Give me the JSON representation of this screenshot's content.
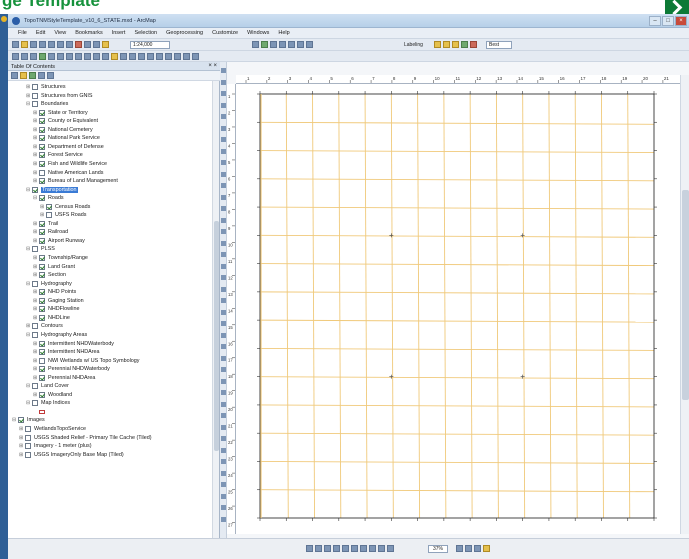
{
  "banner": {
    "heading": "ge Template"
  },
  "window": {
    "title": "TopoTNMStyleTemplate_v10_6_STATE.mxd - ArcMap",
    "buttons": [
      "–",
      "□",
      "×"
    ]
  },
  "menubar": [
    "File",
    "Edit",
    "View",
    "Bookmarks",
    "Insert",
    "Selection",
    "Geoprocessing",
    "Customize",
    "Windows",
    "Help"
  ],
  "toolbar": {
    "scale": "1:24,000",
    "labeling_label": "Labeling",
    "best_label": "Best"
  },
  "toc": {
    "title": "Table Of Contents",
    "close": "× ×",
    "items": [
      {
        "indent": 2,
        "expander": "⊞",
        "checked": false,
        "label": "Structures"
      },
      {
        "indent": 2,
        "expander": "⊞",
        "checked": false,
        "label": "Structures from GNIS"
      },
      {
        "indent": 2,
        "expander": "⊟",
        "checked": false,
        "label": "Boundaries"
      },
      {
        "indent": 3,
        "expander": "⊞",
        "checked": true,
        "label": "State or Territory"
      },
      {
        "indent": 3,
        "expander": "⊞",
        "checked": true,
        "label": "County or Equivalent"
      },
      {
        "indent": 3,
        "expander": "⊞",
        "checked": true,
        "label": "National Cemetery"
      },
      {
        "indent": 3,
        "expander": "⊞",
        "checked": true,
        "label": "National Park Service"
      },
      {
        "indent": 3,
        "expander": "⊞",
        "checked": true,
        "label": "Department of Defense"
      },
      {
        "indent": 3,
        "expander": "⊞",
        "checked": true,
        "label": "Forest Service"
      },
      {
        "indent": 3,
        "expander": "⊞",
        "checked": true,
        "label": "Fish and Wildlife Service"
      },
      {
        "indent": 3,
        "expander": "⊞",
        "checked": false,
        "label": "Native American Lands"
      },
      {
        "indent": 3,
        "expander": "⊞",
        "checked": true,
        "label": "Bureau of Land Management"
      },
      {
        "indent": 2,
        "expander": "⊟",
        "checked": true,
        "label": "Transportation",
        "selected": true
      },
      {
        "indent": 3,
        "expander": "⊟",
        "checked": true,
        "label": "Roads"
      },
      {
        "indent": 4,
        "expander": "⊞",
        "checked": true,
        "label": "Census Roads"
      },
      {
        "indent": 4,
        "expander": "⊞",
        "checked": false,
        "label": "USFS Roads"
      },
      {
        "indent": 3,
        "expander": "⊞",
        "checked": true,
        "label": "Trail"
      },
      {
        "indent": 3,
        "expander": "⊞",
        "checked": true,
        "label": "Railroad"
      },
      {
        "indent": 3,
        "expander": "⊞",
        "checked": true,
        "label": "Airport Runway"
      },
      {
        "indent": 2,
        "expander": "⊟",
        "checked": false,
        "label": "PLSS"
      },
      {
        "indent": 3,
        "expander": "⊞",
        "checked": true,
        "label": "Township/Range"
      },
      {
        "indent": 3,
        "expander": "⊞",
        "checked": true,
        "label": "Land Grant"
      },
      {
        "indent": 3,
        "expander": "⊞",
        "checked": true,
        "label": "Section"
      },
      {
        "indent": 2,
        "expander": "⊟",
        "checked": false,
        "label": "Hydrography"
      },
      {
        "indent": 3,
        "expander": "⊞",
        "checked": true,
        "label": "NHD Points"
      },
      {
        "indent": 3,
        "expander": "⊞",
        "checked": true,
        "label": "Gaging Station"
      },
      {
        "indent": 3,
        "expander": "⊞",
        "checked": true,
        "label": "NHDFlowline"
      },
      {
        "indent": 3,
        "expander": "⊞",
        "checked": true,
        "label": "NHDLine"
      },
      {
        "indent": 2,
        "expander": "⊞",
        "checked": false,
        "label": "Contours"
      },
      {
        "indent": 2,
        "expander": "⊟",
        "checked": false,
        "label": "Hydrography Areas"
      },
      {
        "indent": 3,
        "expander": "⊞",
        "checked": true,
        "label": "Intermittent NHDWaterbody"
      },
      {
        "indent": 3,
        "expander": "⊞",
        "checked": true,
        "label": "Intermittent NHDArea"
      },
      {
        "indent": 3,
        "expander": "⊞",
        "checked": false,
        "label": "NWI Wetlands w/ US Topo Symbology"
      },
      {
        "indent": 3,
        "expander": "⊞",
        "checked": true,
        "label": "Perennial NHDWaterbody"
      },
      {
        "indent": 3,
        "expander": "⊞",
        "checked": true,
        "label": "Perennial NHDArea"
      },
      {
        "indent": 2,
        "expander": "⊟",
        "checked": false,
        "label": "Land Cover"
      },
      {
        "indent": 3,
        "expander": "⊞",
        "checked": true,
        "label": "Woodland"
      },
      {
        "indent": 2,
        "expander": "⊟",
        "checked": false,
        "label": "Map Indices"
      },
      {
        "indent": 3,
        "expander": "",
        "checked": null,
        "label": "",
        "swatch": true
      },
      {
        "indent": 0,
        "expander": "⊟",
        "checked": true,
        "label": "Images"
      },
      {
        "indent": 1,
        "expander": "⊞",
        "checked": false,
        "label": "WetlandsTopoService"
      },
      {
        "indent": 1,
        "expander": "⊞",
        "checked": false,
        "label": "USGS Shaded Relief - Primary Tile Cache (Tiled)"
      },
      {
        "indent": 1,
        "expander": "⊞",
        "checked": false,
        "label": "Imagery - 1 meter (plus)"
      },
      {
        "indent": 1,
        "expander": "⊞",
        "checked": false,
        "label": "USGS ImageryOnly Base Map (Tiled)"
      }
    ]
  },
  "ruler": {
    "h_ticks": [
      1,
      2,
      3,
      4,
      5,
      6,
      7,
      8,
      9,
      10,
      11,
      12,
      13,
      14,
      15,
      16,
      17,
      18,
      19,
      20,
      21
    ],
    "v_ticks": [
      1,
      2,
      3,
      4,
      5,
      6,
      7,
      8,
      9,
      10,
      11,
      12,
      13,
      14,
      15,
      16,
      17,
      18,
      19,
      20,
      21,
      22,
      23,
      24,
      25,
      26,
      27
    ]
  },
  "map": {
    "grid_color": "#f0c97a",
    "border_color": "#333333",
    "columns": 15,
    "rows": 15
  },
  "statusbar": {
    "zoom": "37%",
    "layout_label": ""
  }
}
